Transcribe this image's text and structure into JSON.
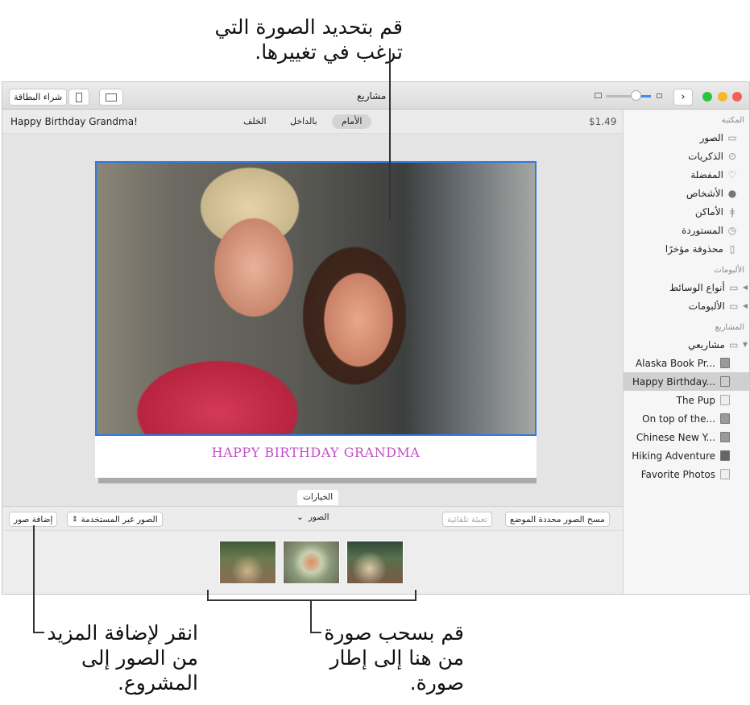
{
  "callouts": {
    "top": [
      "قم بتحديد الصورة التي",
      "ترغب في تغييرها."
    ],
    "bottom_left": [
      "انقر لإضافة المزيد",
      "من الصور إلى",
      "المشروع."
    ],
    "bottom_right": [
      "قم بسحب صورة",
      "من هنا إلى إطار",
      "صورة."
    ]
  },
  "toolbar": {
    "title": "مشاريع",
    "buy_button": "شراء البطاقة",
    "zoom_slider_value": 0.55,
    "forward_icon": "chevron-right-icon"
  },
  "subheader": {
    "project_name": "Happy Birthday Grandma!",
    "tabs": [
      "الأمام",
      "بالداخل",
      "الخلف"
    ],
    "active_tab": "الأمام",
    "price": "$1.49"
  },
  "card": {
    "caption": "HAPPY BIRTHDAY GRANDMA",
    "caption_color": "#c24fc7"
  },
  "options_tab": "الخيارات",
  "bottom": {
    "add_photos": "إضافة صور",
    "unused_photos": "الصور غير المستخدمة",
    "photos_menu": "الصور",
    "autofill": "تعبئة تلقائية",
    "clear_placed": "مسح الصور محددة الموضع"
  },
  "sidebar": {
    "library_header": "المكتبة",
    "library": [
      {
        "label": "الصور",
        "icon": "photos-icon"
      },
      {
        "label": "الذكريات",
        "icon": "memories-icon"
      },
      {
        "label": "المفضلة",
        "icon": "heart-icon"
      },
      {
        "label": "الأشخاص",
        "icon": "person-icon"
      },
      {
        "label": "الأماكن",
        "icon": "pin-icon"
      },
      {
        "label": "المستوردة",
        "icon": "clock-icon"
      },
      {
        "label": "محذوفة مؤخرًا",
        "icon": "trash-icon"
      }
    ],
    "albums_header": "الألبومات",
    "albums": [
      {
        "label": "أنواع الوسائط"
      },
      {
        "label": "الألبومات"
      }
    ],
    "projects_header": "المشاريع",
    "my_projects": "مشاريعي",
    "projects": [
      {
        "label": "Alaska Book Pr..."
      },
      {
        "label": "Happy Birthday...",
        "selected": true
      },
      {
        "label": "The Pup"
      },
      {
        "label": "On top of the..."
      },
      {
        "label": "Chinese New Y..."
      },
      {
        "label": "Hiking Adventure"
      },
      {
        "label": "Favorite Photos"
      }
    ]
  }
}
